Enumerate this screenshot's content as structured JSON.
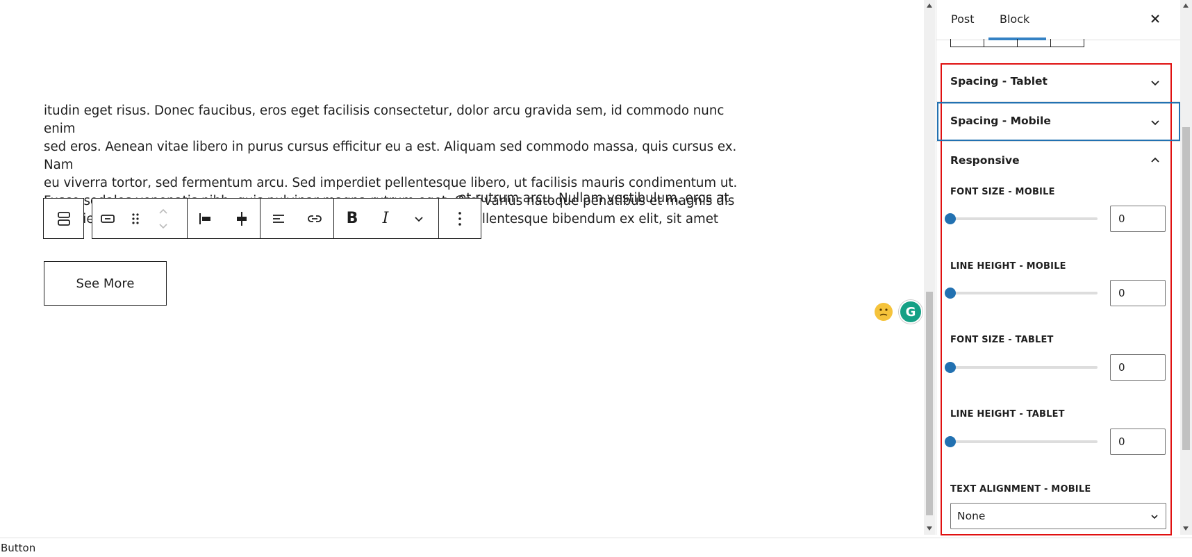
{
  "editor": {
    "paragraph": "itudin eget risus. Donec faucibus, eros eget facilisis consectetur, dolor arcu gravida sem, id commodo nunc enim\nsed eros. Aenean vitae libero in purus cursus efficitur eu a est. Aliquam sed commodo massa, quis cursus ex. Nam\neu viverra tortor, sed fermentum arcu. Sed imperdiet pellentesque libero, ut facilisis mauris condimentum ut.\nFusce sodales venenatis nibh, quis pulvinar magna rutrum eget. Orci varius natoque penatibus et magnis dis\nparturient montes, nascetur ridiculus mus. Sed a molestie mauris. Pellentesque bibendum ex elit, sit amet",
    "paragraph_tail": "et rutrum arcu. Nullam vestibulum, eros at",
    "button_label": "See More"
  },
  "toolbar": {
    "icons": [
      "buttons-parent-icon",
      "button-block-icon",
      "drag-handle-icon",
      "move-up-down-icon",
      "justify-left-icon",
      "justify-center-icon",
      "align-icon",
      "link-icon",
      "bold-icon",
      "italic-icon",
      "more-rich-text-icon",
      "options-icon"
    ]
  },
  "sidebar": {
    "tabs": [
      {
        "label": "Post"
      },
      {
        "label": "Block"
      }
    ],
    "active_tab": "Block",
    "panels": {
      "spacing_tablet": "Spacing - Tablet",
      "spacing_mobile": "Spacing - Mobile",
      "responsive": "Responsive"
    },
    "fields": {
      "font_size_mobile": {
        "label": "FONT SIZE - MOBILE",
        "value": "0"
      },
      "line_height_mobile": {
        "label": "LINE HEIGHT - MOBILE",
        "value": "0"
      },
      "font_size_tablet": {
        "label": "FONT SIZE - TABLET",
        "value": "0"
      },
      "line_height_tablet": {
        "label": "LINE HEIGHT - TABLET",
        "value": "0"
      },
      "text_alignment_mobile": {
        "label": "TEXT ALIGNMENT - MOBILE",
        "value": "None"
      }
    }
  },
  "status_bar": {
    "breadcrumb": "Button"
  },
  "colors": {
    "accent": "#2271b1",
    "highlight_red": "#e01010",
    "highlight_blue": "#2271b1"
  }
}
